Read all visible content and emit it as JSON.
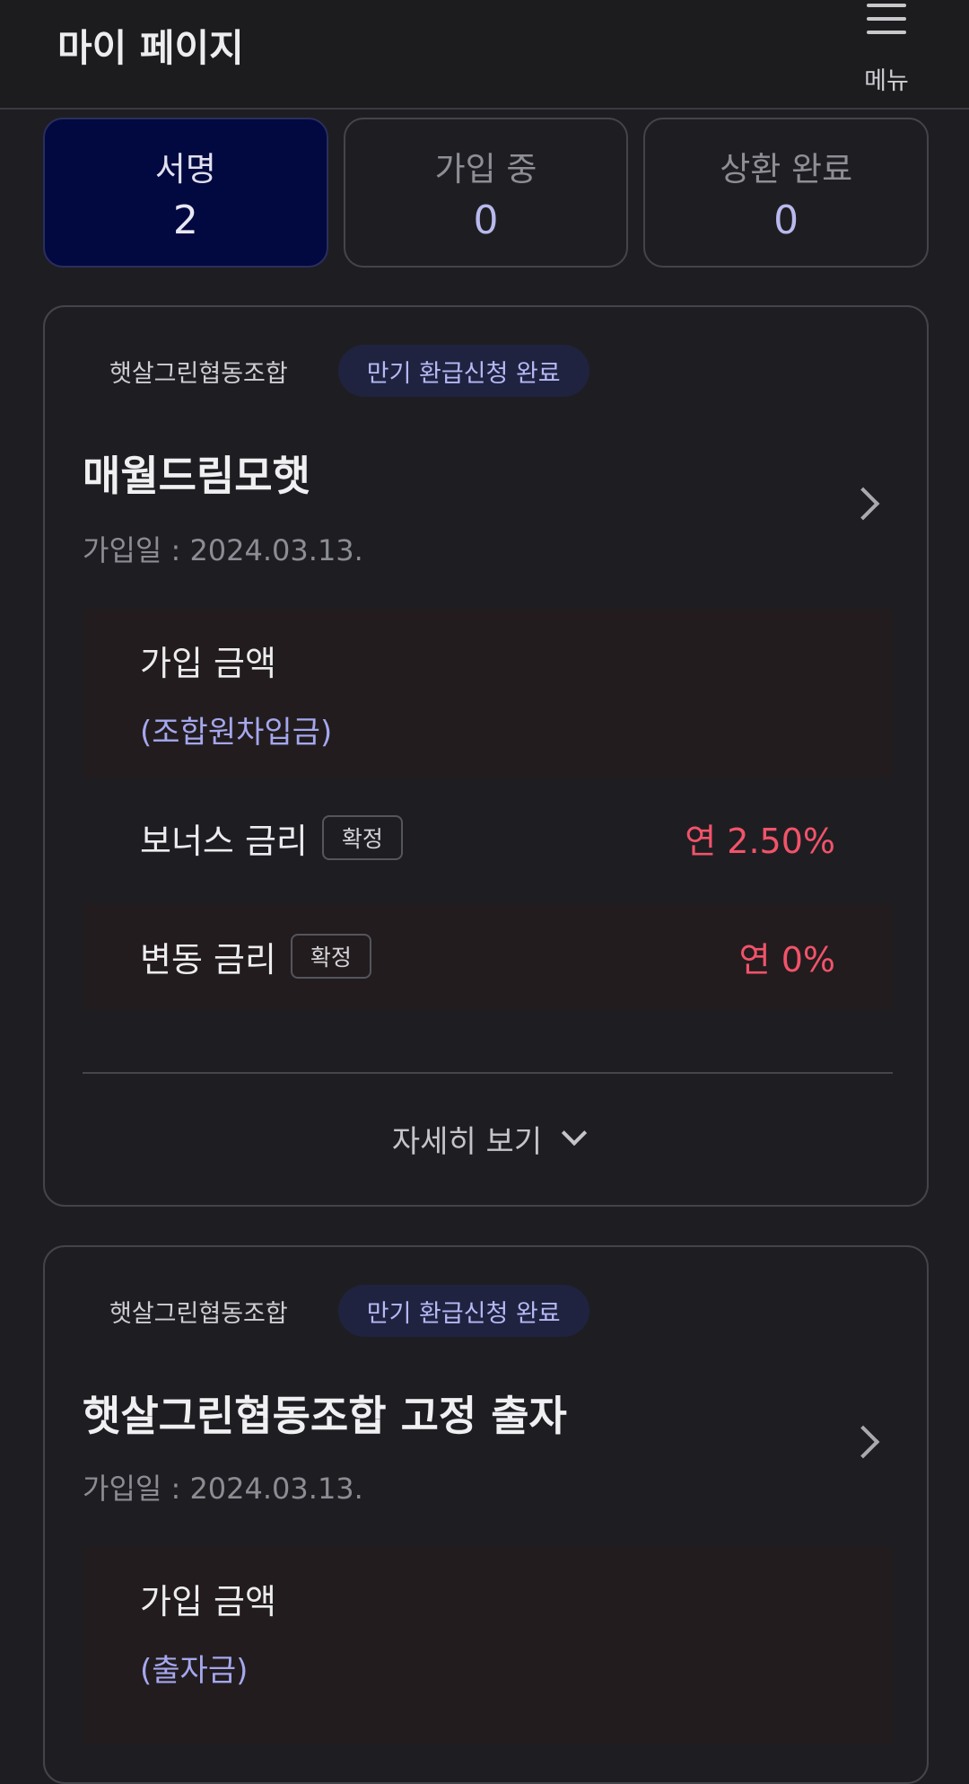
{
  "header": {
    "title": "마이 페이지",
    "menu_label": "메뉴"
  },
  "stats": [
    {
      "label": "서명",
      "value": "2"
    },
    {
      "label": "가입 중",
      "value": "0"
    },
    {
      "label": "상환 완료",
      "value": "0"
    }
  ],
  "cards": [
    {
      "org": "햇살그린협동조합",
      "status": "만기 환급신청 완료",
      "title": "매월드림모햇",
      "join_date": "가입일 : 2024.03.13.",
      "amount_label": "가입 금액",
      "amount_sub": "(조합원차입금)",
      "rates": [
        {
          "label": "보너스 금리",
          "badge": "확정",
          "value": "연 2.50%"
        },
        {
          "label": "변동 금리",
          "badge": "확정",
          "value": "연 0%"
        }
      ],
      "details_label": "자세히 보기"
    },
    {
      "org": "햇살그린협동조합",
      "status": "만기 환급신청 완료",
      "title": "햇살그린협동조합 고정 출자",
      "join_date": "가입일 : 2024.03.13.",
      "amount_label": "가입 금액",
      "amount_sub": "(출자금)"
    }
  ]
}
